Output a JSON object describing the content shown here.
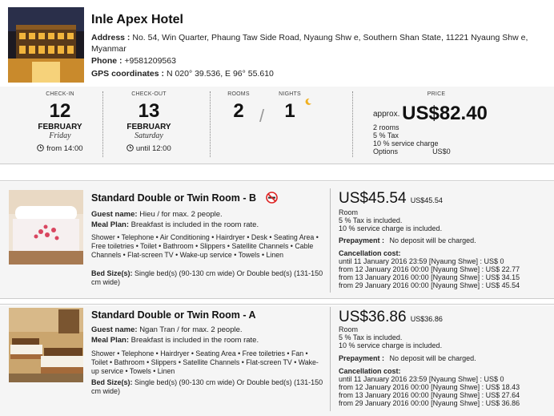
{
  "hotel": {
    "name": "Inle Apex Hotel",
    "address_label": "Address :",
    "address": "No. 54, Win Quarter, Phaung Taw  Side Road, Nyaung Shw e, Southern Shan State, 11221 Nyaung Shw e, Myanmar",
    "phone_label": "Phone :",
    "phone": "+9581209563",
    "gps_label": "GPS coordinates :",
    "gps": "N 020° 39.536, E 96° 55.610"
  },
  "stay": {
    "checkin_label": "CHECK-IN",
    "checkin_day": "12",
    "checkin_month": "FEBRUARY",
    "checkin_weekday": "Friday",
    "checkin_time": "from 14:00",
    "checkout_label": "CHECK-OUT",
    "checkout_day": "13",
    "checkout_month": "FEBRUARY",
    "checkout_weekday": "Saturday",
    "checkout_time": "until 12:00",
    "rooms_label": "ROOMS",
    "rooms": "2",
    "nights_label": "NIGHTS",
    "nights": "1",
    "price_label": "PRICE",
    "price_approx": "approx.",
    "price_total": "US$82.40",
    "price_rooms": "2 rooms",
    "price_tax": "5 % Tax",
    "price_service": "10 % service charge",
    "price_options_label": "Options",
    "price_options_value": "US$0"
  },
  "rooms": [
    {
      "title": "Standard Double or Twin Room - B",
      "guest_label": "Guest name:",
      "guest": "Hieu / for max. 2 people.",
      "meal_label": "Meal Plan:",
      "meal": "Breakfast is included in the room rate.",
      "amenities": "Shower • Telephone • Air Conditioning • Hairdryer • Desk • Seating Area • Free toiletries • Toilet • Bathroom • Slippers • Satellite Channels • Cable Channels • Flat-screen TV • Wake-up service • Towels • Linen",
      "bed_label": "Bed Size(s):",
      "bed": "Single bed(s) (90-130 cm wide) Or Double bed(s) (131-150 cm wide)",
      "price": "US$45.54",
      "price_small": "US$45.54",
      "unit": "Room",
      "tax": "5 % Tax is included.",
      "service": "10 % service charge is included.",
      "prepay_label": "Prepayment :",
      "prepay": "No deposit will be charged.",
      "cancel_label": "Cancellation cost:",
      "cancel_rows": [
        "until 11 January 2016 23:59 [Nyaung Shwe] : US$ 0",
        "from 12 January 2016 00:00 [Nyaung Shwe] : US$ 22.77",
        "from 13 January 2016 00:00 [Nyaung Shwe] : US$ 34.15",
        "from 29 January 2016 00:00 [Nyaung Shwe] : US$ 45.54"
      ]
    },
    {
      "title": "Standard Double or Twin Room - A",
      "guest_label": "Guest name:",
      "guest": "Ngan Tran / for max. 2 people.",
      "meal_label": "Meal Plan:",
      "meal": "Breakfast is included in the room rate.",
      "amenities": "Shower • Telephone • Hairdryer • Seating Area • Free toiletries • Fan • Toilet • Bathroom • Slippers • Satellite Channels • Flat-screen TV • Wake-up service • Towels • Linen",
      "bed_label": "Bed Size(s):",
      "bed": "Single bed(s) (90-130 cm wide) Or Double bed(s) (131-150 cm wide)",
      "price": "US$36.86",
      "price_small": "US$36.86",
      "unit": "Room",
      "tax": "5 % Tax is included.",
      "service": "10 % service charge is included.",
      "prepay_label": "Prepayment :",
      "prepay": "No deposit will be charged.",
      "cancel_label": "Cancellation cost:",
      "cancel_rows": [
        "until 11 January 2016 23:59 [Nyaung Shwe] : US$ 0",
        "from 12 January 2016 00:00 [Nyaung Shwe] : US$ 18.43",
        "from 13 January 2016 00:00 [Nyaung Shwe] : US$ 27.64",
        "from 29 January 2016 00:00 [Nyaung Shwe] : US$ 36.86"
      ]
    }
  ],
  "icons": {
    "no_smoking": "no-smoking-icon",
    "clock": "clock-icon",
    "moon": "moon-icon"
  }
}
